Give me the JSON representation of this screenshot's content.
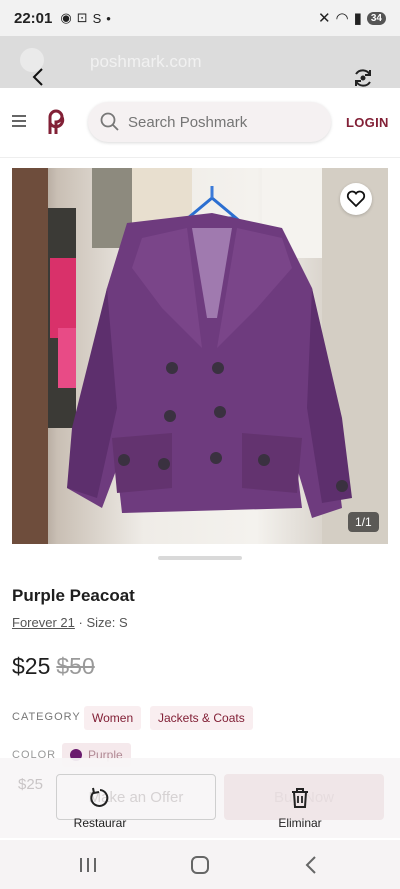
{
  "status_bar": {
    "time": "22:01",
    "battery": "34"
  },
  "browser": {
    "url": "poshmark.com"
  },
  "header": {
    "search_placeholder": "Search Poshmark",
    "login_label": "LOGIN"
  },
  "listing": {
    "image_counter": "1/1",
    "title": "Purple Peacoat",
    "brand": "Forever 21",
    "separator": "·",
    "size": "Size: S",
    "price": "$25",
    "original_price": "$50",
    "category_label": "CATEGORY",
    "categories": [
      "Women",
      "Jackets & Coats"
    ],
    "color_label": "COLOR",
    "color_value": "Purple",
    "color_hex": "#6a1b6e"
  },
  "action_bar": {
    "price_ghost": "$25",
    "offer_label": "Make an Offer",
    "buy_label": "Buy Now",
    "restore_label": "Restaurar",
    "delete_label": "Eliminar"
  },
  "colors": {
    "brand": "#822036",
    "tag_bg": "#f9eef0"
  }
}
